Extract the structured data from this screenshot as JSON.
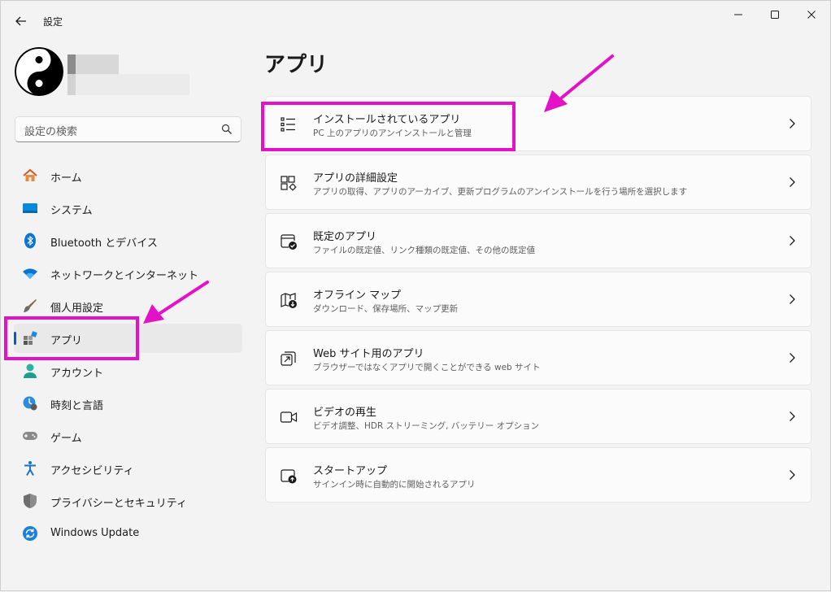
{
  "window": {
    "title": "設定",
    "controls": [
      "minimize-icon",
      "maximize-icon",
      "close-icon"
    ]
  },
  "search": {
    "placeholder": "設定の検索"
  },
  "sidebar": {
    "items": [
      {
        "label": "ホーム",
        "icon": "home-icon"
      },
      {
        "label": "システム",
        "icon": "system-icon"
      },
      {
        "label": "Bluetooth とデバイス",
        "icon": "bluetooth-icon"
      },
      {
        "label": "ネットワークとインターネット",
        "icon": "wifi-icon"
      },
      {
        "label": "個人用設定",
        "icon": "paintbrush-icon"
      },
      {
        "label": "アプリ",
        "icon": "apps-icon",
        "selected": true
      },
      {
        "label": "アカウント",
        "icon": "account-icon"
      },
      {
        "label": "時刻と言語",
        "icon": "time-language-icon"
      },
      {
        "label": "ゲーム",
        "icon": "gamepad-icon"
      },
      {
        "label": "アクセシビリティ",
        "icon": "accessibility-icon"
      },
      {
        "label": "プライバシーとセキュリティ",
        "icon": "shield-icon"
      },
      {
        "label": "Windows Update",
        "icon": "windows-update-icon"
      }
    ]
  },
  "main": {
    "title": "アプリ",
    "cards": [
      {
        "title": "インストールされているアプリ",
        "subtitle": "PC 上のアプリのアンインストールと管理",
        "icon": "installed-apps-list-icon"
      },
      {
        "title": "アプリの詳細設定",
        "subtitle": "アプリの取得、アプリのアーカイブ、更新プログラムのアンインストールを行う場所を選択します",
        "icon": "advanced-app-settings-icon"
      },
      {
        "title": "既定のアプリ",
        "subtitle": "ファイルの既定値、リンク種類の既定値、その他の既定値",
        "icon": "default-apps-icon"
      },
      {
        "title": "オフライン マップ",
        "subtitle": "ダウンロード、保存場所、マップ更新",
        "icon": "offline-maps-icon"
      },
      {
        "title": "Web サイト用のアプリ",
        "subtitle": "ブラウザーではなくアプリで開くことができる web サイト",
        "icon": "apps-for-websites-icon"
      },
      {
        "title": "ビデオの再生",
        "subtitle": "ビデオ調整、HDR ストリーミング, バッテリー オプション",
        "icon": "video-playback-icon"
      },
      {
        "title": "スタートアップ",
        "subtitle": "サインイン時に自動的に開始されるアプリ",
        "icon": "startup-icon"
      }
    ]
  },
  "colors": {
    "accent": "#005fb8",
    "annotation": "#e312c6",
    "background": "#f3f3f3",
    "card": "#fbfbfb"
  }
}
